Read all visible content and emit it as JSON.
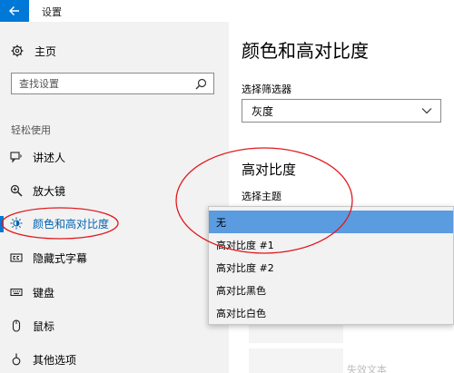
{
  "window": {
    "title": "设置"
  },
  "sidebar": {
    "home_label": "主页",
    "search_placeholder": "查找设置",
    "section_label": "轻松使用",
    "items": [
      {
        "label": "讲述人",
        "icon": "narrator-icon"
      },
      {
        "label": "放大镜",
        "icon": "magnifier-icon"
      },
      {
        "label": "颜色和高对比度",
        "icon": "brightness-icon",
        "active": true
      },
      {
        "label": "隐藏式字幕",
        "icon": "closed-caption-icon"
      },
      {
        "label": "键盘",
        "icon": "keyboard-icon"
      },
      {
        "label": "鼠标",
        "icon": "mouse-icon"
      },
      {
        "label": "其他选项",
        "icon": "other-options-icon"
      }
    ]
  },
  "main": {
    "title": "颜色和高对比度",
    "filter_label": "选择筛选器",
    "filter_value": "灰度",
    "high_contrast_title": "高对比度",
    "theme_label": "选择主题",
    "preview_text": "失效文本"
  },
  "dropdown": {
    "options": [
      "无",
      "高对比度 #1",
      "高对比度 #2",
      "高对比黑色",
      "高对比白色"
    ],
    "selected_index": 0
  },
  "colors": {
    "accent": "#0078d7",
    "active_text": "#0063b1",
    "selected_option": "#5b9be0",
    "sidebar_bg": "#f2f2f2",
    "annotation": "#e0191f"
  }
}
